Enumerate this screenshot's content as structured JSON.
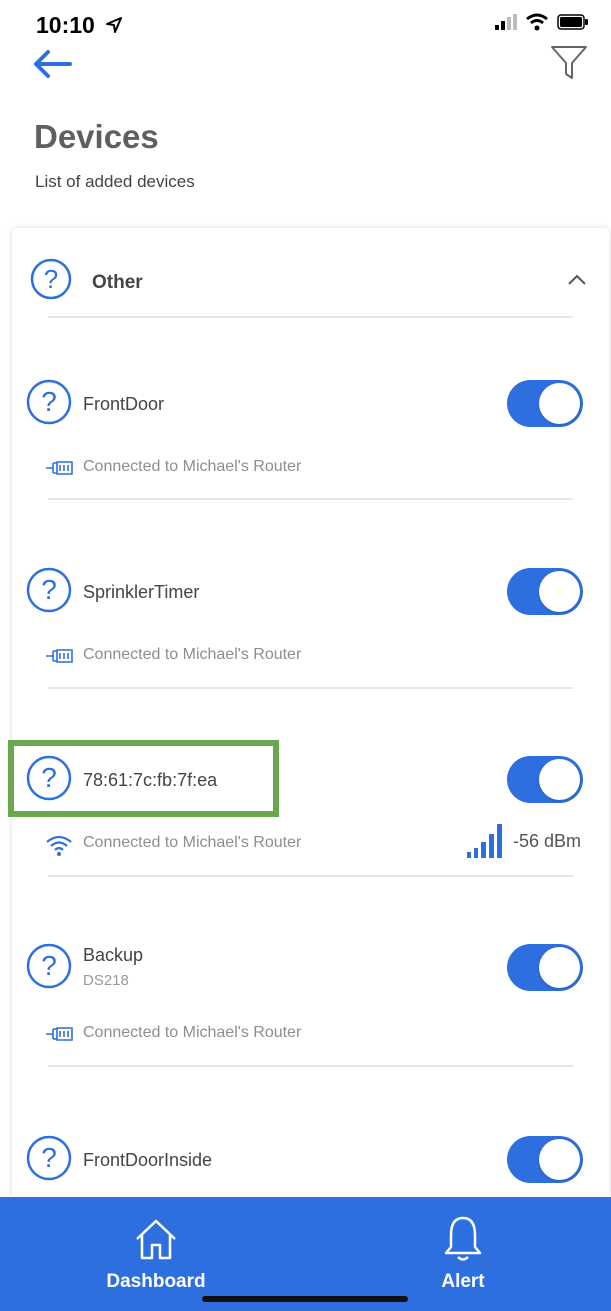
{
  "status": {
    "time": "10:10"
  },
  "header": {
    "title": "Devices",
    "subtitle": "List of added devices"
  },
  "group": {
    "label": "Other",
    "expanded": true
  },
  "devices": [
    {
      "name": "FrontDoor",
      "sub": "",
      "connection": "Connected to  Michael's Router",
      "conn_type": "ethernet",
      "on": true,
      "signal": ""
    },
    {
      "name": "SprinklerTimer",
      "sub": "",
      "connection": "Connected to  Michael's Router",
      "conn_type": "ethernet",
      "on": true,
      "signal": ""
    },
    {
      "name": "78:61:7c:fb:7f:ea",
      "sub": "",
      "connection": "Connected to  Michael's Router",
      "conn_type": "wifi",
      "on": true,
      "signal": "-56  dBm"
    },
    {
      "name": "Backup",
      "sub": "DS218",
      "connection": "Connected to  Michael's Router",
      "conn_type": "ethernet",
      "on": true,
      "signal": ""
    },
    {
      "name": "FrontDoorInside",
      "sub": "",
      "connection": "",
      "conn_type": "",
      "on": true,
      "signal": ""
    }
  ],
  "tabbar": {
    "dashboard": "Dashboard",
    "alert": "Alert"
  },
  "colors": {
    "accent": "#2e6fe0",
    "highlight": "#6aa84f"
  }
}
